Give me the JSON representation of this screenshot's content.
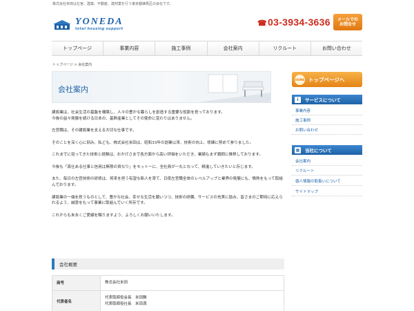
{
  "header": {
    "tagline": "株式会社米田は左官、建築、不動産、建材業を行う東京都練馬区の会社です。",
    "logo_name": "YONEDA",
    "logo_sub": "total housing support",
    "phone": "03-3934-3636",
    "mail_line1": "メールでの",
    "mail_line2": "お問合せ"
  },
  "nav": [
    "トップページ",
    "事業内容",
    "施工事例",
    "会社案内",
    "リクルート",
    "お問い合わせ"
  ],
  "breadcrumb": "トップページ > 会社案内",
  "page_title": "会社案内",
  "paragraphs": [
    "建設業は、社会生活の基盤を構築し、人々の豊かな暮らしを創造する重要な役割を担っております。\n今後の益々発展を続ける日本の、基幹産業としてその使命に変わりはありません。",
    "左官職は、その建設業を支える大切な仕事です。",
    "そのことを深く心に刻み、私ども、株式会社米田は、昭和33年の創業以来、技術の向上、修練に努めて参りました。",
    "これまでに培ってきた技術と経験は、おかげさまで各方面から高い評価をいただき、業績もまず順調に推移しております。",
    "今後も「真仕ある仕事と信用は無限の資なり」をモットーに、全社員が一丸となって、精進していきたいと存じます。",
    "また、毎日の左官技術の研修は、将来を担う有望な新人を育て、日夜左官職全体のレベルアップと業界の発展にも、情熱をもって取組んでおります。",
    "建設業の一端を担うものとして、豊かな社会、幸せな生活を願いつつ、技術の研鑽、サービスの充実に励み、皆さまのご期待に応えられるよう、誠意をもって事業に取組んでいく所存です。",
    "これからも末永くご愛顧を賜りますよう、よろしくお願いいたします。"
  ],
  "overview": {
    "title": "会社概要",
    "rows": [
      {
        "label": "商号",
        "value": "株式会社米田"
      },
      {
        "label": "代表者名",
        "value": "代表取締役会長　米田勝\n代表取締役社長　米田満"
      }
    ]
  },
  "sidebar": {
    "banner_badge": "HOME",
    "banner_label": "トップページへ",
    "service_head": "サービスについて",
    "service_links": [
      "事業内容",
      "施工事例",
      "お問い合わせ"
    ],
    "company_head": "当社について",
    "company_links": [
      "会社案内",
      "リクルート",
      "個人情報の取扱いについて",
      "サイトマップ"
    ]
  },
  "colors": {
    "brand_blue": "#1d62a8",
    "phone_red": "#cc2a1c",
    "accent_orange": "#e48416"
  }
}
